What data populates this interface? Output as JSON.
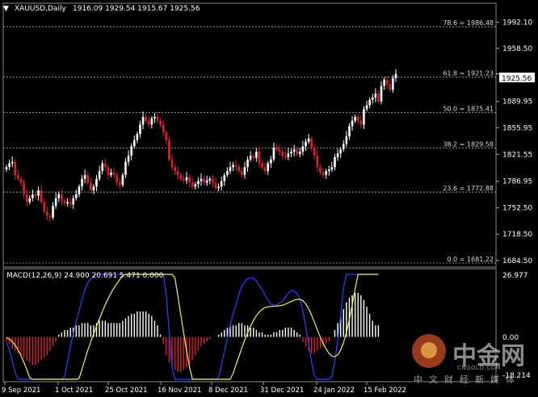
{
  "header": {
    "symbol": "XAUUSD,Daily",
    "ohlc": "1916.09 1929.54 1915.67 1925.56"
  },
  "macd": {
    "label": "MACD(12,26,9) 24.900 20.691 5.471 0.000",
    "scale_top": "26.977",
    "scale_zero": "0.00",
    "scale_bottom": "-18.214"
  },
  "current_price": "1925.56",
  "price_axis": [
    "1992.10",
    "1958.50",
    "1925.56",
    "1889.95",
    "1855.95",
    "1821.55",
    "1786.95",
    "1752.50",
    "1718.50",
    "1684.50"
  ],
  "fib_levels": [
    {
      "label": "78.6 = 1986.48",
      "price": 1986.48
    },
    {
      "label": "61.8 = 1921.23",
      "price": 1921.23
    },
    {
      "label": "50.0 = 1875.41",
      "price": 1875.41
    },
    {
      "label": "38.2 = 1829.58",
      "price": 1829.58
    },
    {
      "label": "23.6 = 1772.88",
      "price": 1772.88
    },
    {
      "label": "0.0 = 1681.22",
      "price": 1681.22
    }
  ],
  "date_axis": [
    "9 Sep 2021",
    "1 Oct 2021",
    "25 Oct 2021",
    "16 Nov 2021",
    "8 Dec 2021",
    "31 Dec 2021",
    "24 Jan 2022",
    "15 Feb 2022"
  ],
  "watermark": {
    "brand": "中金网",
    "site": "CNGOLD.COM",
    "sub": "中文财经新媒体"
  },
  "colors": {
    "bull": "#ffffff",
    "bear": "#e0202a",
    "macd_line": "#2a3cff",
    "signal_line": "#f0f060",
    "fib": "#bbbbbb"
  },
  "chart_data": {
    "type": "candlestick",
    "price_scale": [
      1681.22,
      1998.0
    ],
    "closes": [
      1805,
      1810,
      1812,
      1795,
      1790,
      1785,
      1770,
      1760,
      1765,
      1770,
      1768,
      1775,
      1760,
      1748,
      1742,
      1740,
      1755,
      1765,
      1770,
      1762,
      1758,
      1760,
      1757,
      1765,
      1770,
      1780,
      1790,
      1795,
      1785,
      1775,
      1780,
      1790,
      1800,
      1810,
      1805,
      1795,
      1798,
      1795,
      1785,
      1782,
      1795,
      1812,
      1820,
      1832,
      1840,
      1848,
      1860,
      1870,
      1865,
      1860,
      1868,
      1870,
      1865,
      1860,
      1850,
      1840,
      1815,
      1805,
      1800,
      1795,
      1790,
      1788,
      1792,
      1785,
      1780,
      1783,
      1787,
      1790,
      1785,
      1788,
      1790,
      1785,
      1778,
      1780,
      1787,
      1795,
      1800,
      1805,
      1808,
      1806,
      1800,
      1795,
      1805,
      1815,
      1820,
      1817,
      1825,
      1810,
      1805,
      1800,
      1810,
      1815,
      1830,
      1828,
      1825,
      1820,
      1818,
      1823,
      1825,
      1828,
      1822,
      1825,
      1832,
      1838,
      1842,
      1830,
      1820,
      1805,
      1798,
      1795,
      1800,
      1802,
      1805,
      1818,
      1823,
      1828,
      1835,
      1845,
      1858,
      1865,
      1870,
      1865,
      1860,
      1880,
      1885,
      1892,
      1895,
      1900,
      1890,
      1910,
      1918,
      1912,
      1905,
      1920,
      1925.56
    ],
    "macd_hist": [
      -2,
      -3,
      -5,
      -6,
      -7,
      -8,
      -9,
      -10,
      -11,
      -12,
      -12,
      -11,
      -10,
      -9,
      -8,
      -6,
      -4,
      -2,
      1,
      2,
      3,
      3,
      4,
      4,
      5,
      5,
      6,
      6,
      6,
      5,
      5,
      6,
      7,
      7,
      7,
      6,
      6,
      6,
      6,
      6,
      7,
      8,
      9,
      10,
      10,
      11,
      11,
      11,
      11,
      10,
      9,
      7,
      5,
      1,
      -3,
      -8,
      -11,
      -13,
      -14,
      -15,
      -15,
      -14,
      -13,
      -12,
      -10,
      -8,
      -6,
      -4,
      -3,
      -2,
      -1,
      0,
      0,
      1,
      2,
      3,
      4,
      5,
      5,
      5,
      6,
      6,
      5,
      5,
      4,
      4,
      3,
      2,
      2,
      1,
      1,
      1,
      2,
      2,
      3,
      3,
      4,
      4,
      4,
      3,
      2,
      1,
      -2,
      -4,
      -6,
      -7,
      -7,
      -6,
      -5,
      -4,
      -3,
      -2,
      0,
      3,
      6,
      9,
      12,
      15,
      17,
      18,
      19,
      19,
      18,
      16,
      13,
      10,
      7,
      5,
      5
    ],
    "macd_range": [
      -18.214,
      26.977
    ],
    "xlabel": "",
    "ylabel": ""
  }
}
